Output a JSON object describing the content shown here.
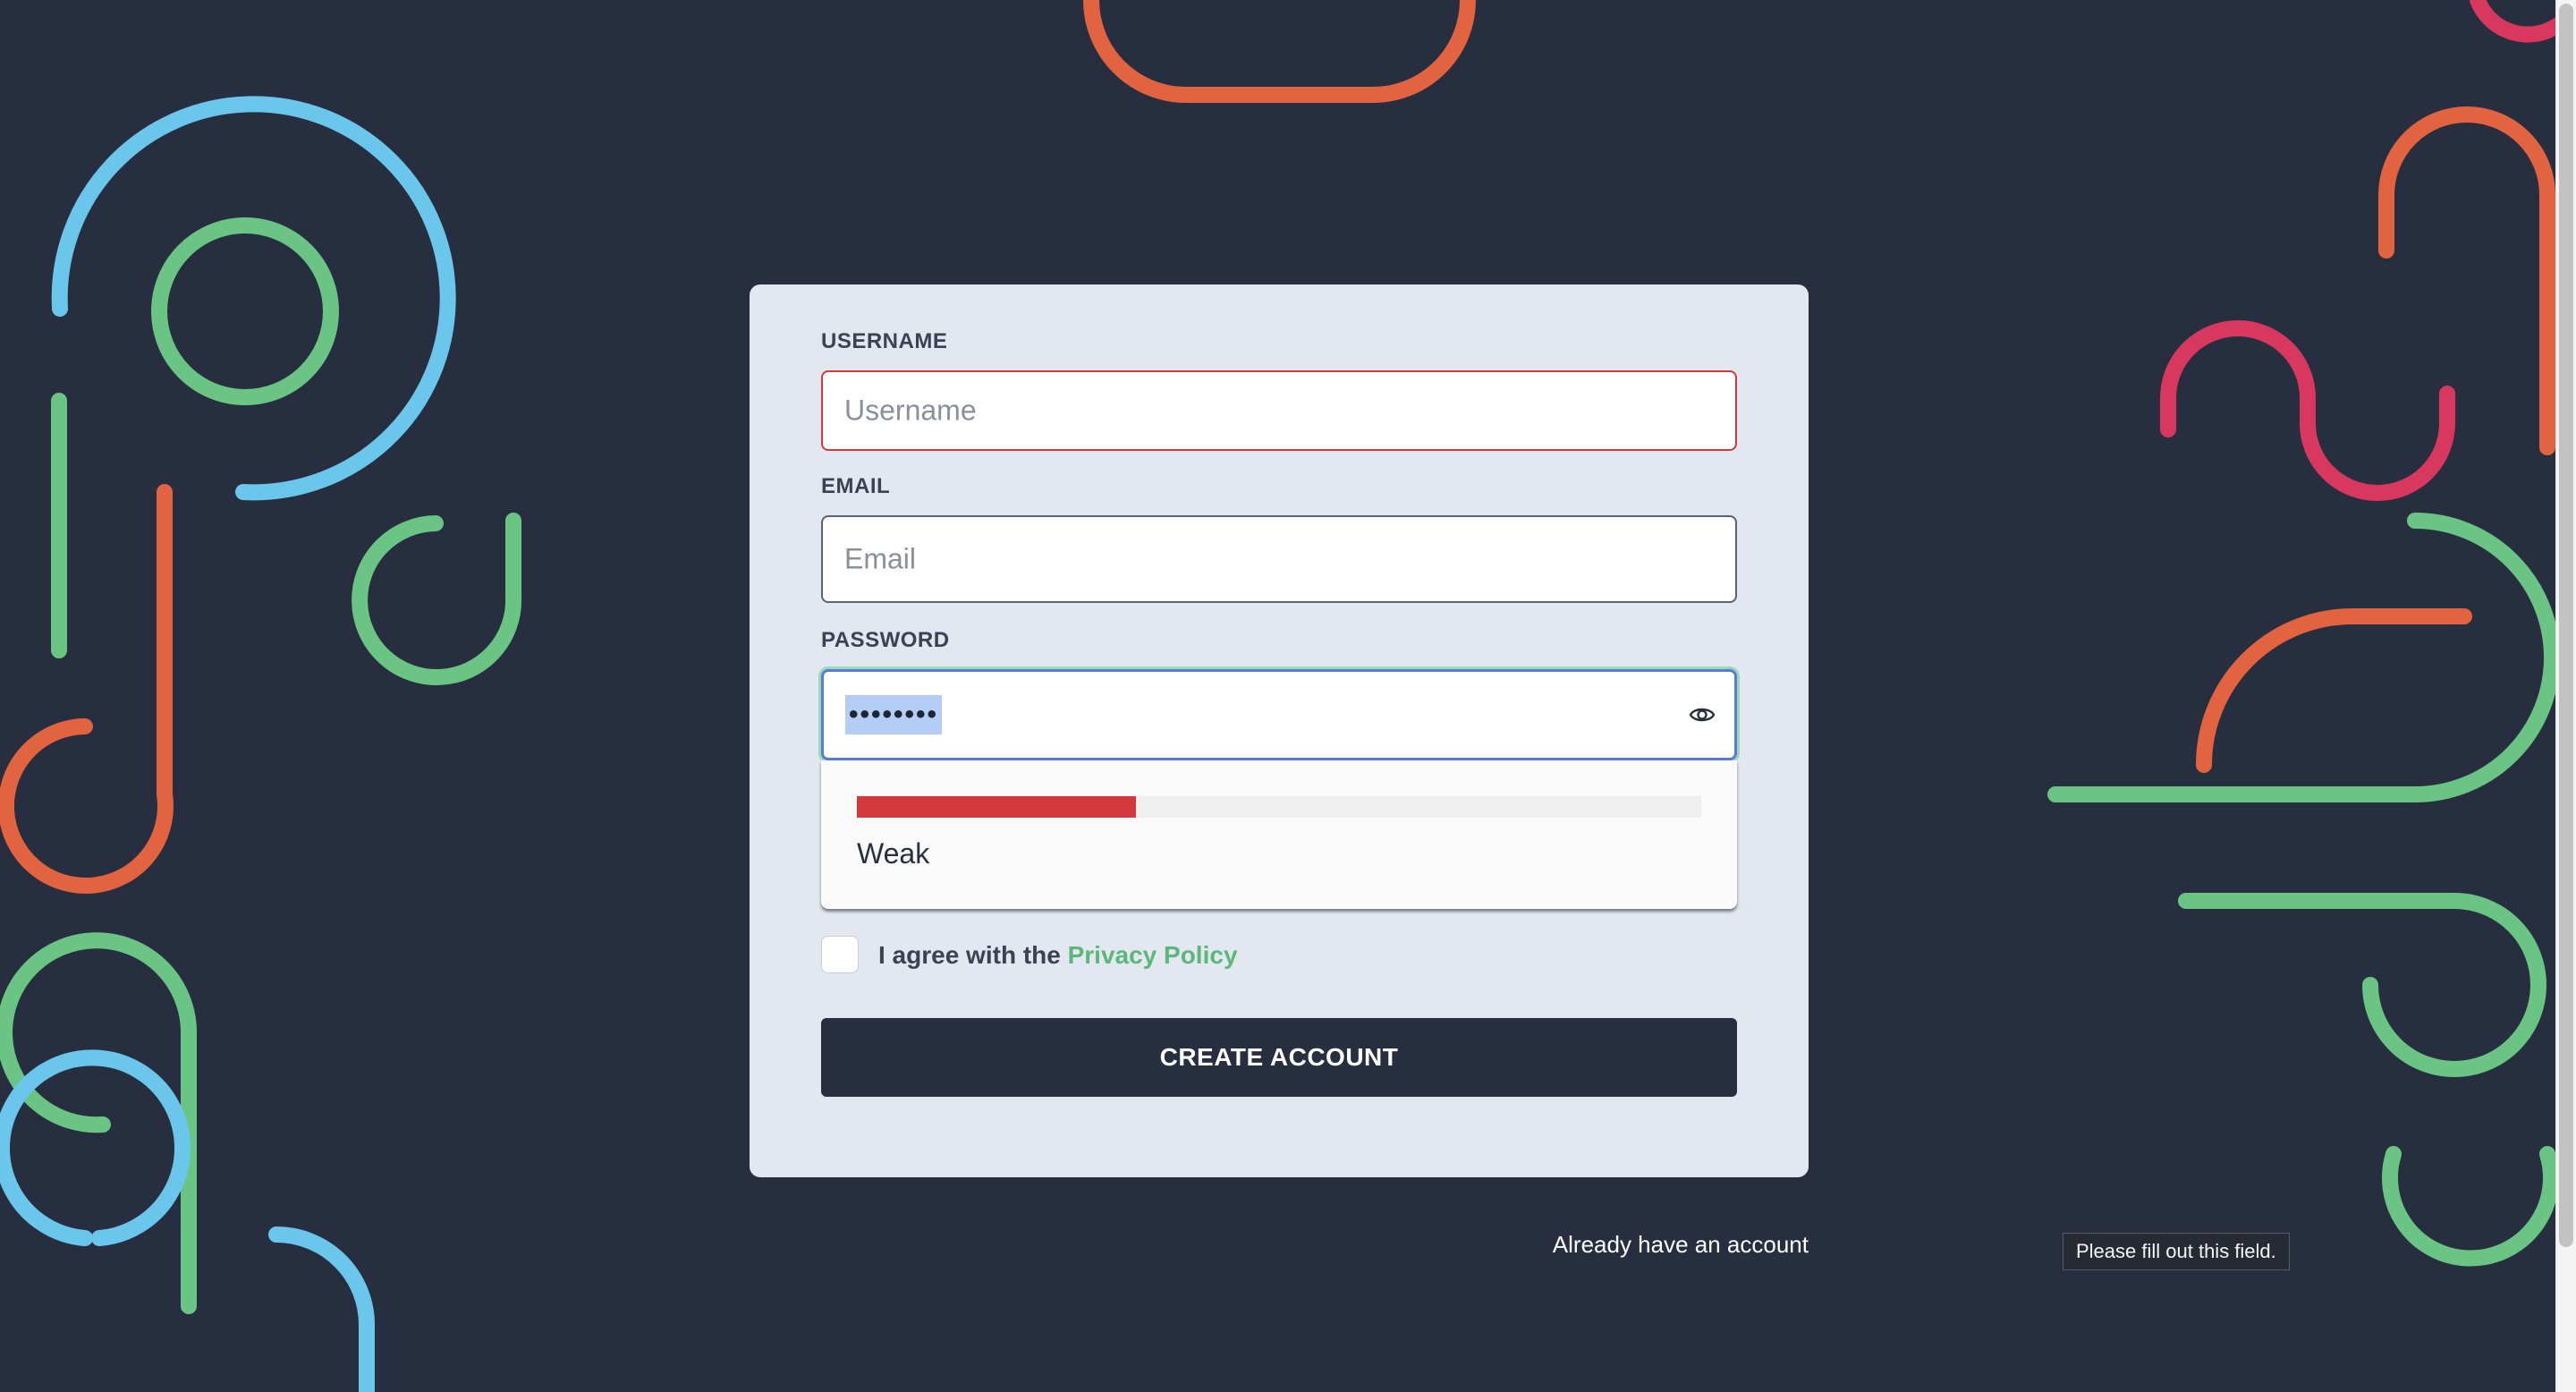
{
  "form": {
    "username": {
      "label": "USERNAME",
      "placeholder": "Username"
    },
    "email": {
      "label": "EMAIL",
      "placeholder": "Email"
    },
    "password": {
      "label": "PASSWORD",
      "masked_value": "••••••••",
      "toggle_icon": "eye-icon"
    },
    "strength": {
      "label": "Weak",
      "level_fraction": 0.33,
      "color": "#d2383c"
    },
    "agree": {
      "checked": false,
      "text": "I agree with the",
      "link_text": "Privacy Policy"
    },
    "submit_label": "CREATE ACCOUNT"
  },
  "login_link": "Already have an account",
  "validation_tooltip": "Please fill out this field.",
  "colors": {
    "background": "#272e3f",
    "card": "#e3e7ef",
    "accent_green": "#5cb77a",
    "error_red": "#d1383b",
    "focus_blue": "#5b79d9"
  }
}
